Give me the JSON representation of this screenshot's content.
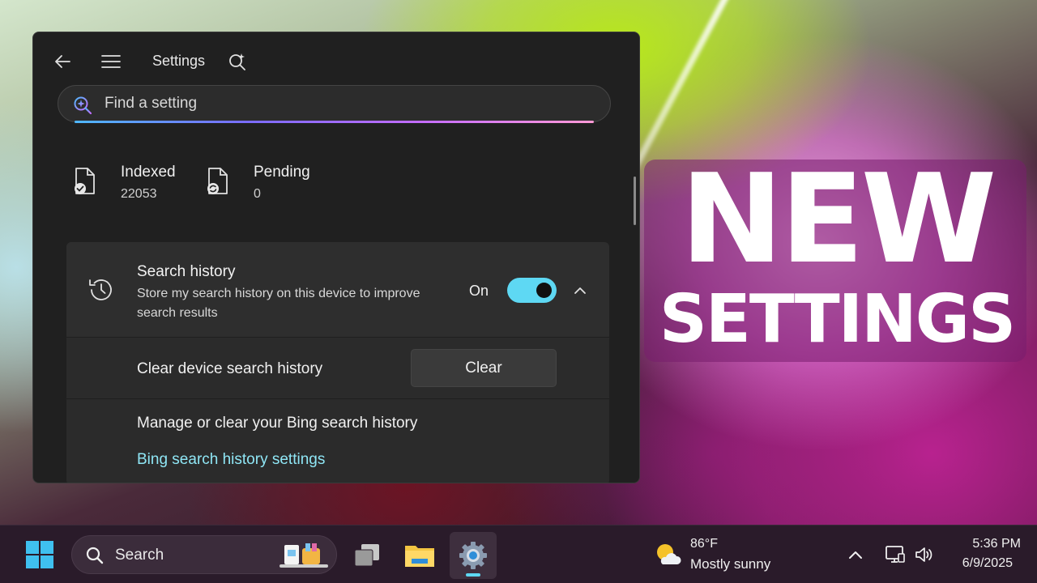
{
  "settings_window": {
    "title": "Settings",
    "search": {
      "placeholder": "Find a setting"
    },
    "indexing": {
      "indexed": {
        "label": "Indexed",
        "value": "22053"
      },
      "pending": {
        "label": "Pending",
        "value": "0"
      }
    },
    "search_history": {
      "title": "Search history",
      "description": "Store my search history on this device to improve search results",
      "toggle_state_label": "On",
      "toggle_on": true,
      "clear_row": {
        "label": "Clear device search history",
        "button": "Clear"
      },
      "bing": {
        "label": "Manage or clear your Bing search history",
        "link": "Bing search history settings"
      }
    }
  },
  "banner": {
    "line1": "NEW",
    "line2": "SETTINGS"
  },
  "taskbar": {
    "search_label": "Search",
    "apps": [
      "task-view",
      "file-explorer",
      "settings"
    ],
    "active_app": "settings",
    "weather": {
      "temp": "86°F",
      "condition": "Mostly sunny"
    },
    "clock": {
      "time": "5:36 PM",
      "date": "6/9/2025"
    }
  },
  "colors": {
    "accent": "#5ed8f3",
    "window_bg": "#202020",
    "card_bg": "#2b2b2b",
    "link": "#8fe6f5",
    "taskbar_bg": "#2a1b2a"
  }
}
